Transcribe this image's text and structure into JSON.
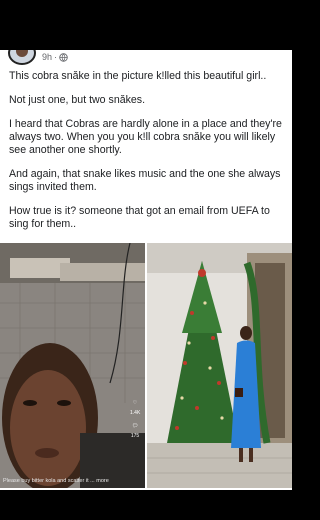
{
  "post": {
    "time": "9h",
    "separator": "·",
    "privacy_icon": "globe-icon",
    "paragraphs": [
      "This cobra snăke in the picture k!lled this beautiful girl..",
      "Not just one, but two snăkes.",
      "I heard that Cobras are hardly alone in a place and they're always two. When you you k!ll cobra snăke you will likely see another one shortly.",
      "And again,  that snake likes music and the one she always sings invited them.",
      "How true is it? someone that got an email from UEFA to sing for them.."
    ]
  },
  "media": {
    "video_caption": "Please buy bitter kola and scatter it ... more",
    "video_side_count_1": "1.4K",
    "video_side_count_2": "175"
  },
  "colors": {
    "text": "#1c1e21",
    "meta": "#65676b",
    "dress": "#2b7fd6",
    "tree": "#2f6a2c"
  }
}
